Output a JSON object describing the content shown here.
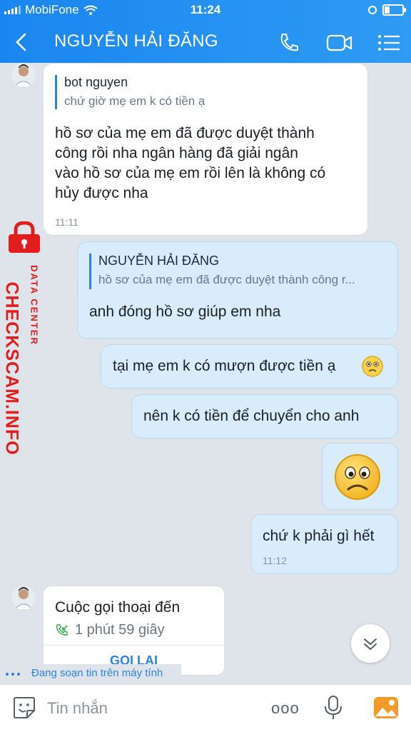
{
  "status_bar": {
    "carrier": "MobiFone",
    "time": "11:24"
  },
  "header": {
    "contact_name": "NGUYỄN HẢI ĐĂNG"
  },
  "watermark": {
    "brand": "CHECKSCAM.INFO",
    "sub": "DATA CENTER"
  },
  "messages": [
    {
      "side": "in",
      "quote_author": "bot nguyen",
      "quote_text": "chứ giờ mẹ em k có tiền ạ",
      "lines": [
        "hồ sơ của mẹ em đã được duyệt thành",
        "công rồi nha ngân hàng đã giải ngân",
        "vào hồ sơ của mẹ em rồi lên là không có",
        "hủy được nha"
      ],
      "time": "11:11"
    },
    {
      "side": "out",
      "quote_author": "NGUYỄN HẢI ĐĂNG",
      "quote_text": "hồ sơ của mẹ em đã được duyệt thành công r...",
      "text": "anh đóng hồ sơ giúp em nha"
    },
    {
      "side": "out",
      "text": "tại mẹ em k có mượn được tiền ạ",
      "emoji": "🙁"
    },
    {
      "side": "out",
      "text": "nên k có tiền để chuyển cho anh"
    },
    {
      "side": "out",
      "sticker": "sad-face"
    },
    {
      "side": "out",
      "text": "chứ k phải gì hết",
      "time": "11:12"
    }
  ],
  "call": {
    "title": "Cuộc gọi thoại đến",
    "duration": "1 phút 59 giây",
    "callback_label": "GỌI LẠI"
  },
  "typing_indicator": "Đang soạn tin trên máy tính",
  "composer": {
    "placeholder": "Tin nhắn",
    "more_label": "ooo"
  }
}
